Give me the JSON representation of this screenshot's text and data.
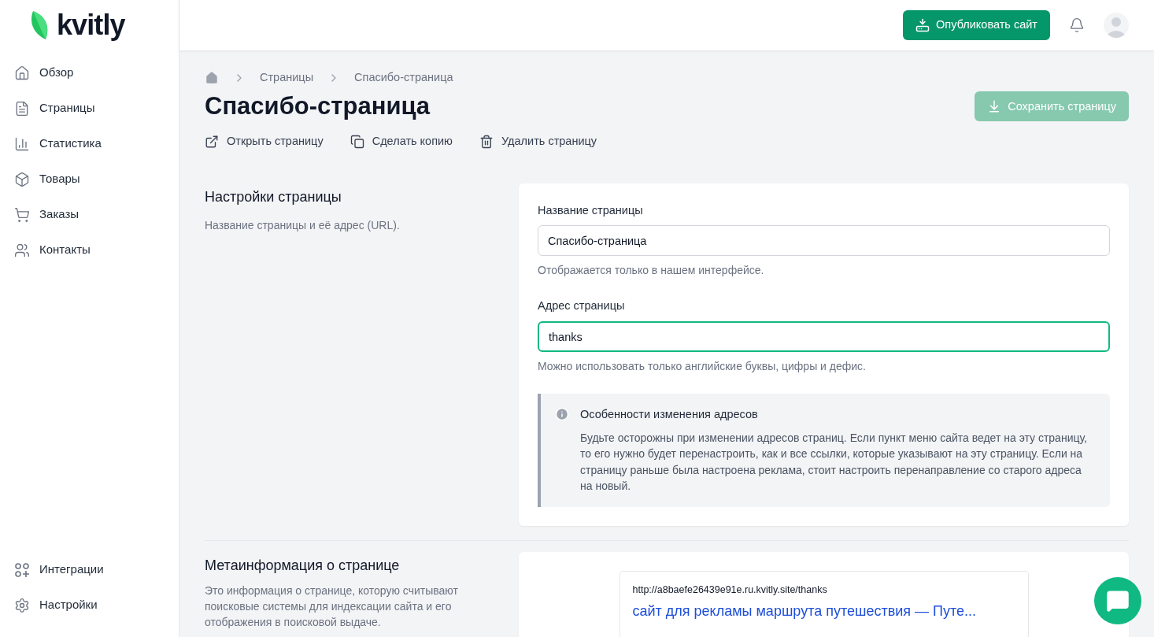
{
  "logo": "kvitly",
  "nav": [
    {
      "label": "Обзор",
      "kind": "home"
    },
    {
      "label": "Страницы",
      "kind": "file"
    },
    {
      "label": "Статистика",
      "kind": "chart"
    },
    {
      "label": "Товары",
      "kind": "box"
    },
    {
      "label": "Заказы",
      "kind": "cart"
    },
    {
      "label": "Контакты",
      "kind": "users"
    }
  ],
  "nav_bottom": [
    {
      "label": "Интеграции",
      "kind": "integrations"
    },
    {
      "label": "Настройки",
      "kind": "settings"
    }
  ],
  "header": {
    "publish_button": "Опубликовать сайт"
  },
  "breadcrumbs": [
    "Страницы",
    "Спасибо-страница"
  ],
  "title": "Спасибо-страница",
  "save_button": {
    "label": "Сохранить страницу",
    "disabled": true
  },
  "actions": [
    {
      "label": "Открыть страницу",
      "kind": "external"
    },
    {
      "label": "Сделать копию",
      "kind": "copy"
    },
    {
      "label": "Удалить страницу",
      "kind": "trash"
    }
  ],
  "settings_section": {
    "title": "Настройки страницы",
    "description": "Название страницы и её адрес (URL).",
    "fields": [
      {
        "label": "Название страницы",
        "value": "Спасибо-страница",
        "hint": "Отображается только в нашем интерфейсе.",
        "focused": false
      },
      {
        "label": "Адрес страницы",
        "value": "thanks",
        "hint": "Можно использовать только английские буквы, цифры и дефис.",
        "focused": true
      }
    ],
    "notice": {
      "title": "Особенности изменения адресов",
      "text": "Будьте осторожны при изменении адресов страниц. Если пункт меню сайта ведет на эту страницу, то его нужно будет перенастроить, как и все ссылки, которые указывают на эту страницу. Если на страницу раньше была настроена реклама, стоит настроить перенаправление со старого адреса на новый."
    }
  },
  "meta_section": {
    "title": "Метаинформация о странице",
    "description": "Это информация о странице, которую считывают поисковые системы для индексации сайта и его отображения в поисковой выдаче.",
    "preview": {
      "url": "http://a8baefe26439e91e.ru.kvitly.site/thanks",
      "title": "сайт для рекламы маршрута путешествия — Путе..."
    }
  }
}
